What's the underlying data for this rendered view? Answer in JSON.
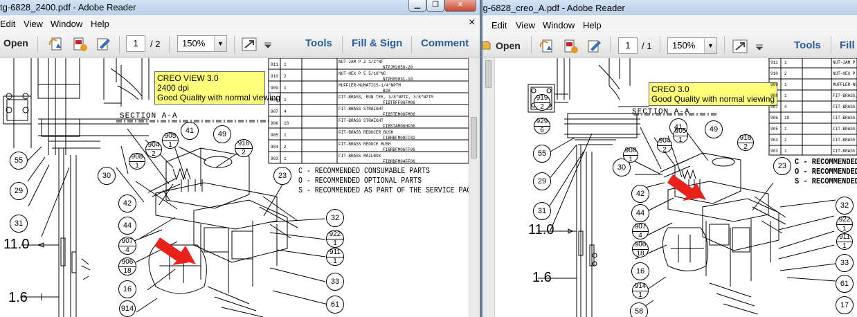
{
  "left": {
    "title": "tg-6828_2400.pdf - Adobe Reader",
    "menu": [
      "Edit",
      "View",
      "Window",
      "Help"
    ],
    "close_glyph": "×",
    "toolbar": {
      "open": "Open",
      "page": "1",
      "page_total": "/ 2",
      "zoom": "150%",
      "tools": "Tools",
      "fill_sign": "Fill & Sign",
      "comment": "Comment"
    },
    "note": [
      "CREO VIEW 3.0",
      "2400 dpi",
      "Good Quality with normal viewing"
    ],
    "section_label": "SECTION  A-A",
    "table_rows": [
      {
        "item": "911",
        "qty": "1",
        "desc": "NUT-JAM P 2  1/2\"NF",
        "part": "NTPJM2050-20"
      },
      {
        "item": "910",
        "qty": "2",
        "desc": "NUT-HEX P 5  5/16\"NC",
        "part": "NTPHX5031-18"
      },
      {
        "item": "909",
        "qty": "1",
        "desc": "MUFFLER-NUMATICS-1/4\"NPTM",
        "part": "B28"
      },
      {
        "item": "908",
        "qty": "1",
        "desc": "FIT-BRASS, RUN TEE, 3/8\"NPTF, 3/8\"NPTM",
        "part": "FIBTRFF06FM06"
      },
      {
        "item": "907",
        "qty": "4",
        "desc": "FIT-BRASS STRAIGHT",
        "part": "FIBSTEM06FM06"
      },
      {
        "item": "906",
        "qty": "18",
        "desc": "FIT-BRASS STRAIGHT",
        "part": "FIBSTAM06HF06"
      },
      {
        "item": "905",
        "qty": "1",
        "desc": "FIT-BRASS REDUCER BUSH",
        "part": "FIBRBFM08FF02"
      },
      {
        "item": "904",
        "qty": "2",
        "desc": "FIT-BRASS REDUCE BUSH",
        "part": "FIBRBFM06FF06"
      },
      {
        "item": "903",
        "qty": "1",
        "desc": "FIT-BRASS MAILBOX",
        "part": "FIBRBFM04FF06"
      }
    ],
    "legend": [
      "C - RECOMMENDED CONSUMABLE PARTS",
      "O - RECOMMENDED OPTIONAL PARTS",
      "S - RECOMMENDED AS PART OF THE SERVICE PACK"
    ],
    "dims": [
      "11.0",
      "1.6"
    ]
  },
  "right": {
    "title": "ltg-6828_creo_A.pdf - Adobe Reader",
    "menu": [
      "Edit",
      "View",
      "Window",
      "Help"
    ],
    "toolbar": {
      "open": "Open",
      "page": "1",
      "page_total": "/ 1",
      "zoom": "150%",
      "tools": "Tools",
      "fill": "Fill"
    },
    "note": [
      "CREO 3.0",
      "Good Quality with normal viewing"
    ],
    "section_label": "SECTION  A-A",
    "table_rows": [
      "911",
      "910",
      "909",
      "908",
      "907",
      "906",
      "905",
      "904",
      "903"
    ],
    "table_qty": [
      "1",
      "2",
      "1",
      "1",
      "4",
      "18",
      "1",
      "2",
      "1"
    ],
    "table_desc": [
      "NUT-JAM P",
      "NUT-HEX P",
      "MUFFLER-NUMA",
      "FIT-BRASS, R",
      "FIT-BRASS S",
      "FIT-BRASS S",
      "FIT-BRASS R",
      "FIT-BRASS R",
      "FIT-BRASS M"
    ],
    "legend": [
      "C - RECOMMENDED C",
      "O - RECOMMENDED O",
      "S - RECOMMENDED A"
    ],
    "dims": [
      "11.0",
      "1.6"
    ]
  },
  "colors": {
    "note_bg": "#ffff7a",
    "arrow": "#e8211a",
    "link_blue": "#2a5d9c",
    "title_bg": "#c7d8ef"
  }
}
